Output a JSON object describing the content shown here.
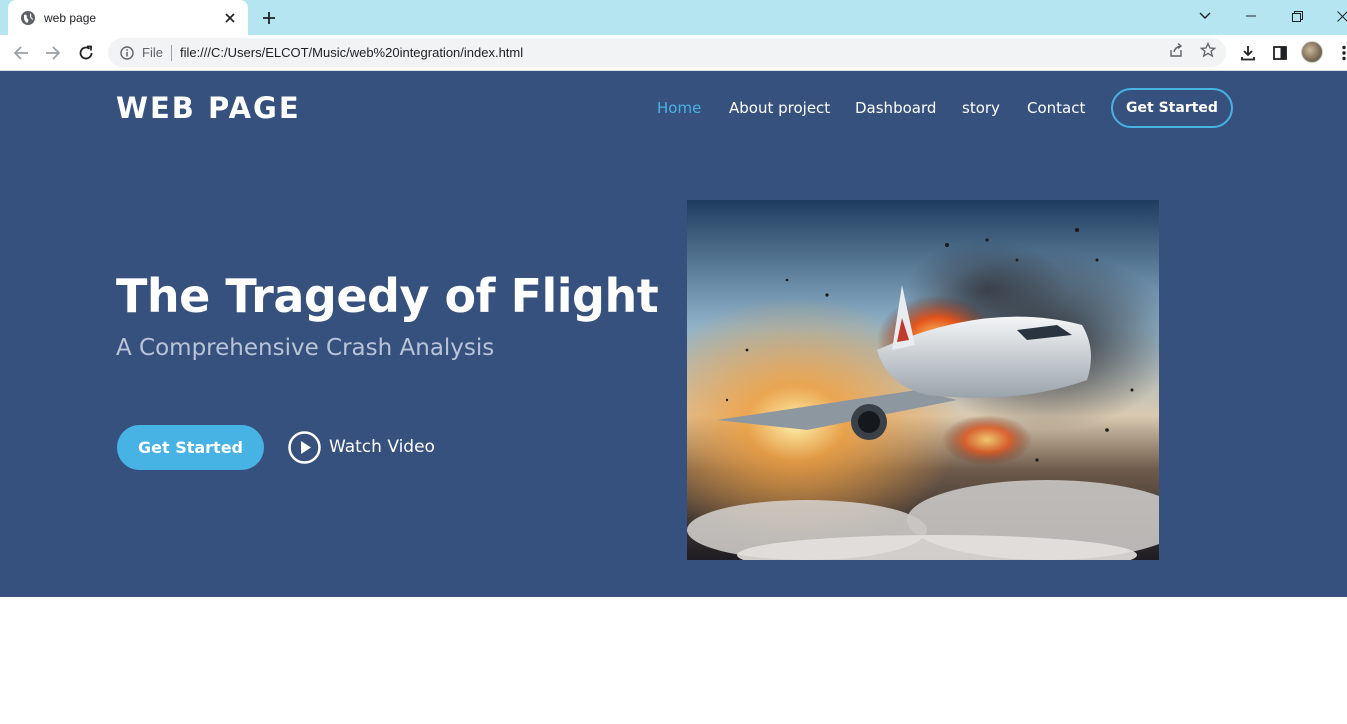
{
  "browser": {
    "tab_title": "web page",
    "omnibox_scheme_label": "File",
    "url": "file:///C:/Users/ELCOT/Music/web%20integration/index.html"
  },
  "site": {
    "logo": "WEB PAGE",
    "nav": [
      {
        "label": "Home",
        "active": true
      },
      {
        "label": "About project",
        "active": false
      },
      {
        "label": "Dashboard",
        "active": false
      },
      {
        "label": "story",
        "active": false
      },
      {
        "label": "Contact",
        "active": false
      }
    ],
    "nav_cta": "Get Started"
  },
  "hero": {
    "title": "The Tragedy of Flight",
    "subtitle": "A Comprehensive Crash Analysis",
    "cta": "Get Started",
    "watch_label": "Watch Video"
  },
  "colors": {
    "hero_bg": "#37517e",
    "accent": "#47b2e4",
    "tabbar_bg": "#b6e5f2"
  }
}
